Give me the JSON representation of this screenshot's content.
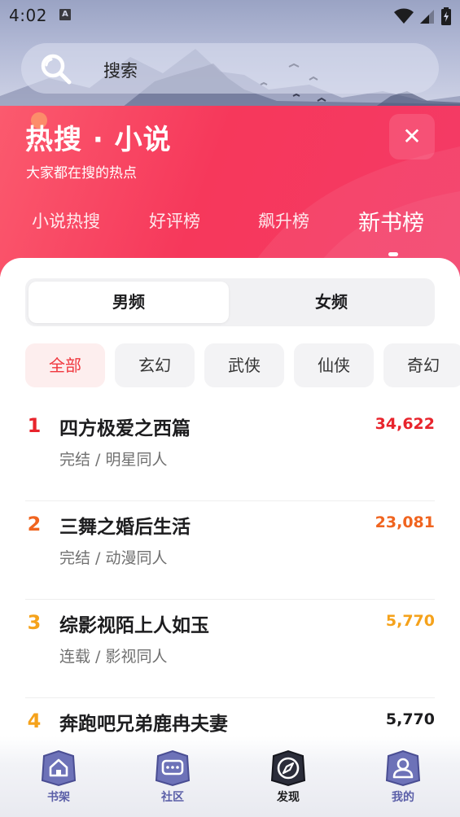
{
  "status_bar": {
    "time": "4:02",
    "notification_badge": "A",
    "icons": [
      "wifi-icon",
      "signal-icon",
      "battery-charging-icon"
    ]
  },
  "search": {
    "placeholder": "搜索",
    "icon": "search-icon"
  },
  "hot_search": {
    "title": "热搜 · 小说",
    "subtitle": "大家都在搜的热点",
    "close_label": "✕",
    "tabs": [
      {
        "label": "小说热搜",
        "active": false
      },
      {
        "label": "好评榜",
        "active": false
      },
      {
        "label": "飙升榜",
        "active": false
      },
      {
        "label": "新书榜",
        "active": true
      }
    ]
  },
  "gender_toggle": {
    "options": [
      {
        "label": "男频",
        "active": true
      },
      {
        "label": "女频",
        "active": false
      }
    ]
  },
  "categories": [
    {
      "label": "全部",
      "active": true
    },
    {
      "label": "玄幻",
      "active": false
    },
    {
      "label": "武侠",
      "active": false
    },
    {
      "label": "仙侠",
      "active": false
    },
    {
      "label": "奇幻",
      "active": false
    }
  ],
  "rankings": [
    {
      "rank": "1",
      "title": "四方极爱之西篇",
      "status": "完结",
      "category": "明星同人",
      "meta": "完结 / 明星同人",
      "count": "34,622",
      "color": "#e8242c"
    },
    {
      "rank": "2",
      "title": "三舞之婚后生活",
      "status": "完结",
      "category": "动漫同人",
      "meta": "完结 / 动漫同人",
      "count": "23,081",
      "color": "#f0641f"
    },
    {
      "rank": "3",
      "title": "综影视陌上人如玉",
      "status": "连载",
      "category": "影视同人",
      "meta": "连载 / 影视同人",
      "count": "5,770",
      "color": "#f5a21b"
    },
    {
      "rank": "4",
      "title": "奔跑吧兄弟鹿冉夫妻",
      "meta": "",
      "count": "5,770",
      "color": "#f5a21b",
      "count_color": "#1d1d1f"
    }
  ],
  "bottom_nav": [
    {
      "label": "书架",
      "icon": "bookshelf-home-icon",
      "active": false
    },
    {
      "label": "社区",
      "icon": "community-chat-icon",
      "active": false
    },
    {
      "label": "发现",
      "icon": "discover-compass-icon",
      "active": true
    },
    {
      "label": "我的",
      "icon": "profile-user-icon",
      "active": false
    }
  ],
  "colors": {
    "header_red": "#f6385b",
    "active_chip_text": "#f0383f",
    "nav_icon_blue": "#5b5fa8"
  }
}
